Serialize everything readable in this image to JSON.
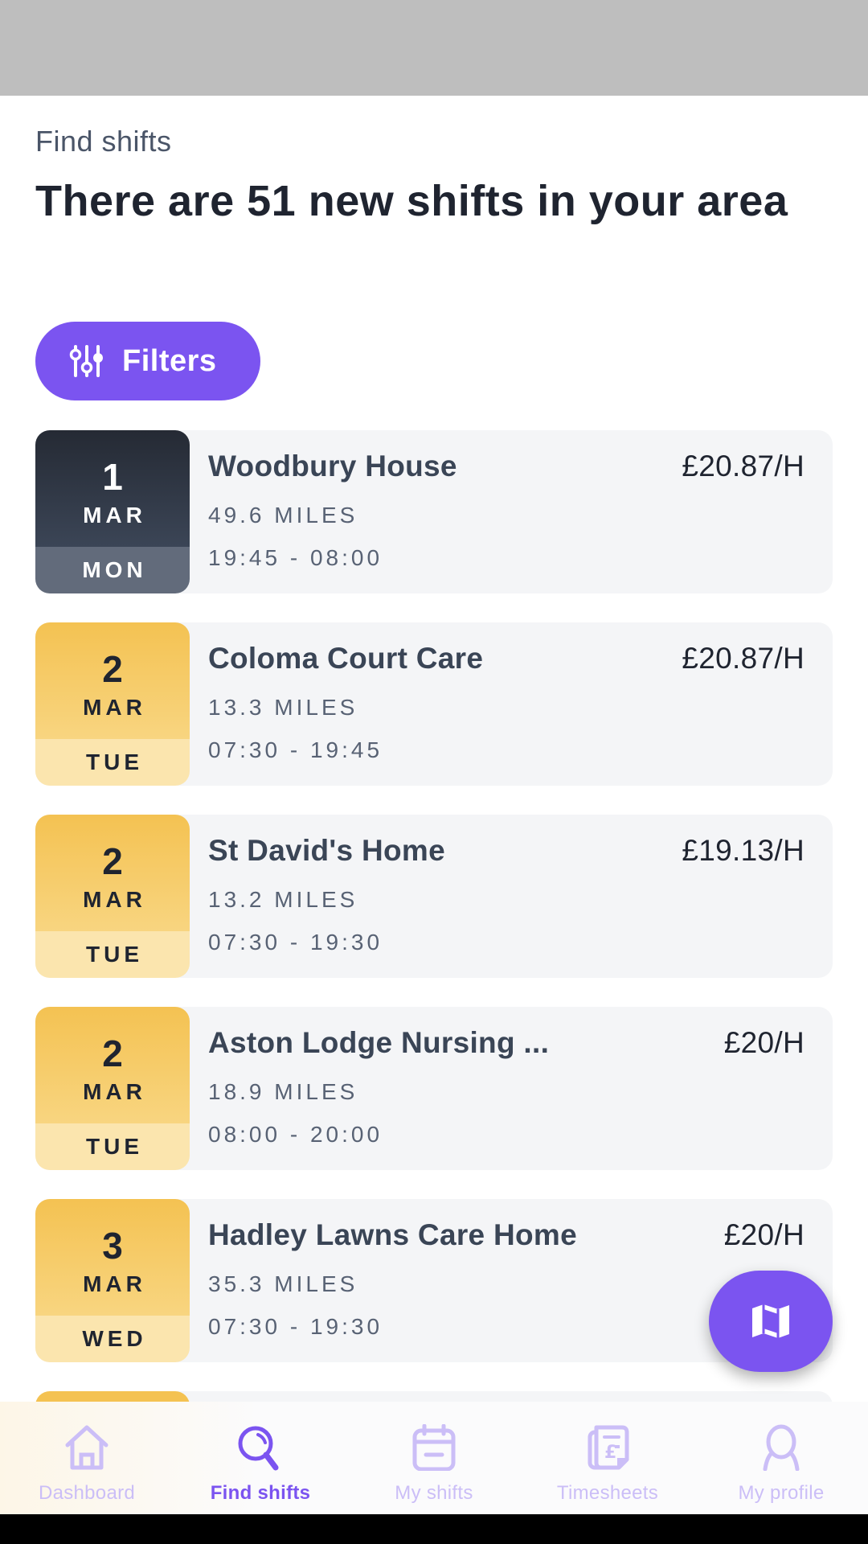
{
  "header": {
    "eyebrow": "Find shifts",
    "headline": "There are 51 new shifts in your area"
  },
  "filters": {
    "label": "Filters",
    "icon": "sliders-icon"
  },
  "shifts": [
    {
      "day": "1",
      "month": "MAR",
      "weekday": "MON",
      "style": "dark",
      "name": "Woodbury House",
      "rate": "£20.87/H",
      "distance": "49.6 MILES",
      "time": "19:45 - 08:00"
    },
    {
      "day": "2",
      "month": "MAR",
      "weekday": "TUE",
      "style": "yellow",
      "name": "Coloma Court Care",
      "rate": "£20.87/H",
      "distance": "13.3 MILES",
      "time": "07:30 - 19:45"
    },
    {
      "day": "2",
      "month": "MAR",
      "weekday": "TUE",
      "style": "yellow",
      "name": "St David's Home",
      "rate": "£19.13/H",
      "distance": "13.2 MILES",
      "time": "07:30 - 19:30"
    },
    {
      "day": "2",
      "month": "MAR",
      "weekday": "TUE",
      "style": "yellow",
      "name": "Aston Lodge Nursing ...",
      "rate": "£20/H",
      "distance": "18.9 MILES",
      "time": "08:00 - 20:00"
    },
    {
      "day": "3",
      "month": "MAR",
      "weekday": "WED",
      "style": "yellow",
      "name": "Hadley Lawns Care Home",
      "rate": "£20/H",
      "distance": "35.3 MILES",
      "time": "07:30 - 19:30"
    }
  ],
  "map_button": {
    "icon": "map-icon"
  },
  "nav": [
    {
      "label": "Dashboard",
      "icon": "home-icon",
      "active": false
    },
    {
      "label": "Find shifts",
      "icon": "search-icon",
      "active": true
    },
    {
      "label": "My shifts",
      "icon": "calendar-icon",
      "active": false
    },
    {
      "label": "Timesheets",
      "icon": "timesheet-icon",
      "active": false
    },
    {
      "label": "My profile",
      "icon": "profile-icon",
      "active": false
    }
  ],
  "colors": {
    "accent": "#7b54f0",
    "accent_light": "#cbbef7",
    "date_dark": "#2b3240",
    "date_yellow": "#f4c252",
    "card_bg": "#f4f5f7"
  }
}
